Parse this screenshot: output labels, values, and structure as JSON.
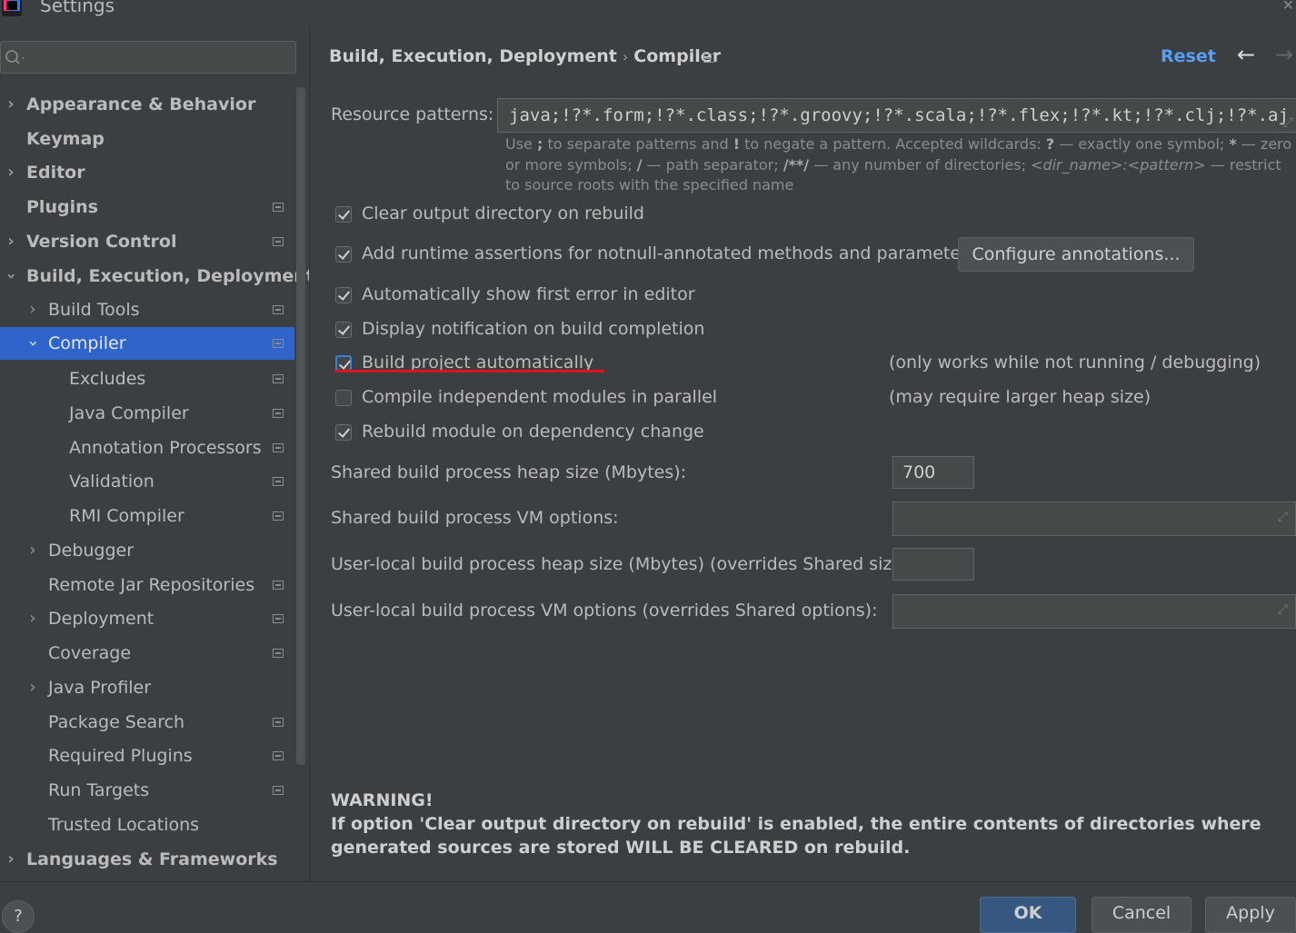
{
  "window": {
    "title": "Settings"
  },
  "search": {
    "placeholder": ""
  },
  "sidebar": {
    "items": [
      {
        "label": "Appearance & Behavior"
      },
      {
        "label": "Keymap"
      },
      {
        "label": "Editor"
      },
      {
        "label": "Plugins"
      },
      {
        "label": "Version Control"
      },
      {
        "label": "Build, Execution, Deployment"
      },
      {
        "label": "Build Tools"
      },
      {
        "label": "Compiler"
      },
      {
        "label": "Excludes"
      },
      {
        "label": "Java Compiler"
      },
      {
        "label": "Annotation Processors"
      },
      {
        "label": "Validation"
      },
      {
        "label": "RMI Compiler"
      },
      {
        "label": "Debugger"
      },
      {
        "label": "Remote Jar Repositories"
      },
      {
        "label": "Deployment"
      },
      {
        "label": "Coverage"
      },
      {
        "label": "Java Profiler"
      },
      {
        "label": "Package Search"
      },
      {
        "label": "Required Plugins"
      },
      {
        "label": "Run Targets"
      },
      {
        "label": "Trusted Locations"
      },
      {
        "label": "Languages & Frameworks"
      }
    ],
    "selected": "Compiler"
  },
  "header": {
    "breadcrumb_parent": "Build, Execution, Deployment",
    "breadcrumb_sep": "›",
    "breadcrumb_current": "Compiler",
    "reset_label": "Reset",
    "back_glyph": "←",
    "forward_glyph": "→"
  },
  "resource": {
    "label": "Resource patterns:",
    "value": "java;!?*.form;!?*.class;!?*.groovy;!?*.scala;!?*.flex;!?*.kt;!?*.clj;!?*.aj",
    "hint": {
      "p1": "Use ",
      "semi": ";",
      "p2": " to separate patterns and ",
      "bang": "!",
      "p3": " to negate a pattern. Accepted wildcards: ",
      "q": "?",
      "p4": " — exactly one symbol; ",
      "star": "*",
      "p5": " — zero or more symbols; ",
      "slash": "/",
      "p6": " — path separator; ",
      "dstar": "/**/",
      "p7": " — any number of directories; ",
      "dirname": "<dir_name>:<pattern>",
      "p8": " — restrict to source roots with the specified name"
    }
  },
  "options": [
    {
      "label": "Clear output directory on rebuild",
      "checked": true
    },
    {
      "label": "Add runtime assertions for notnull-annotated methods and parameters",
      "checked": true
    },
    {
      "label": "Automatically show first error in editor",
      "checked": true
    },
    {
      "label": "Display notification on build completion",
      "checked": true
    },
    {
      "label": "Build project automatically",
      "checked": true
    },
    {
      "label": "Compile independent modules in parallel",
      "checked": false
    },
    {
      "label": "Rebuild module on dependency change",
      "checked": true
    }
  ],
  "configure_annotations_label": "Configure annotations...",
  "notes": {
    "build_auto": "(only works while not running / debugging)",
    "parallel": "(may require larger heap size)"
  },
  "fields": {
    "shared_heap_label": "Shared build process heap size (Mbytes):",
    "shared_heap_value": "700",
    "shared_vm_label": "Shared build process VM options:",
    "shared_vm_value": "",
    "user_heap_label": "User-local build process heap size (Mbytes) (overrides Shared size):",
    "user_heap_value": "",
    "user_vm_label": "User-local build process VM options (overrides Shared options):",
    "user_vm_value": ""
  },
  "warning": {
    "title": "WARNING!",
    "text": "If option 'Clear output directory on rebuild' is enabled, the entire contents of directories where generated sources are stored WILL BE CLEARED on rebuild."
  },
  "footer": {
    "help": "?",
    "ok": "OK",
    "cancel": "Cancel",
    "apply": "Apply"
  },
  "colors": {
    "background": "#3c3f41",
    "selection": "#2f65ca",
    "link": "#589df6",
    "annotation_underline": "#e0141e"
  }
}
